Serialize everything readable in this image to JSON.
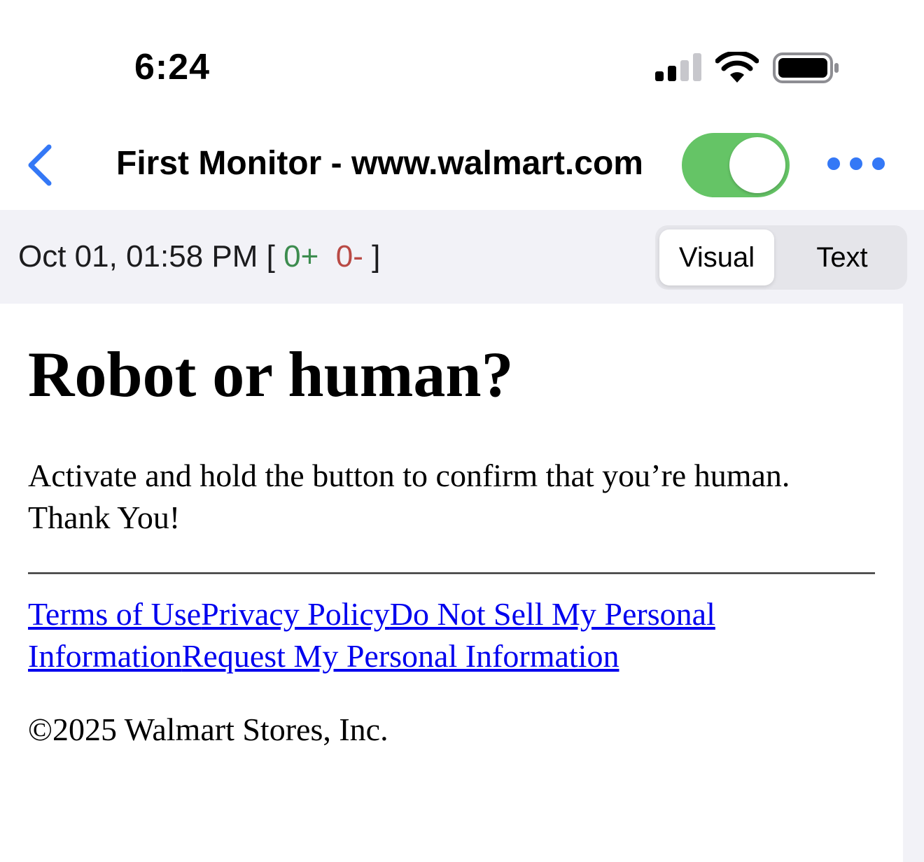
{
  "status_bar": {
    "time": "6:24",
    "icons": [
      "cellular-signal-icon",
      "wifi-icon",
      "battery-icon"
    ]
  },
  "nav": {
    "back_icon": "chevron-left-icon",
    "title": "First Monitor - www.walmart.com",
    "toggle_on": true,
    "more_icon": "ellipsis-icon"
  },
  "snapshot": {
    "timestamp": "Oct 01, 01:58 PM",
    "open_bracket": "[",
    "added": "0+",
    "removed": "0-",
    "close_bracket": "]"
  },
  "view_mode": {
    "options": [
      "Visual",
      "Text"
    ],
    "selected": "Visual"
  },
  "page": {
    "heading": "Robot or human?",
    "body_line1": "Activate and hold the button to confirm that you’re human.",
    "body_line2": "Thank You!",
    "links": [
      "Terms of Use",
      "Privacy Policy",
      "Do Not Sell My Personal Information",
      "Request My Personal Information"
    ],
    "copyright": "©2025 Walmart Stores, Inc."
  },
  "colors": {
    "accent": "#3478f6",
    "toggle_on": "#65c466",
    "added": "#3d8c4f",
    "removed": "#b94a45",
    "link": "#0000ee"
  }
}
